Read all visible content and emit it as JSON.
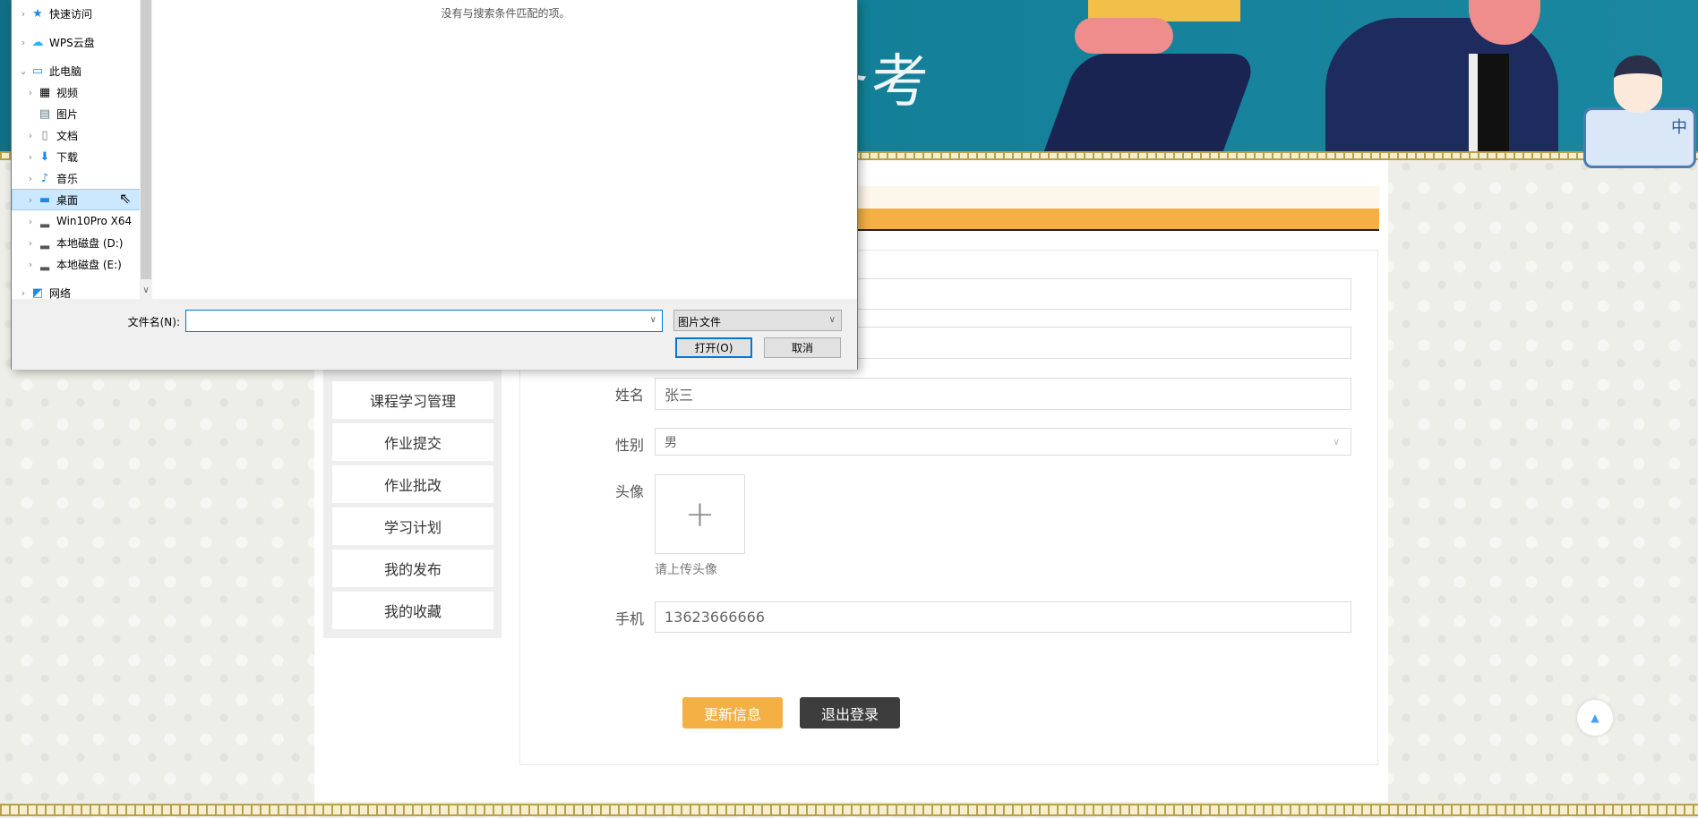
{
  "banner": {
    "title": "备考",
    "mascot_text": "中"
  },
  "menu": {
    "items": [
      "课程学习管理",
      "作业提交",
      "作业批改",
      "学习计划",
      "我的发布",
      "我的收藏"
    ]
  },
  "form": {
    "name_label": "姓名",
    "name_value": "张三",
    "gender_label": "性别",
    "gender_value": "男",
    "avatar_label": "头像",
    "avatar_hint": "请上传头像",
    "phone_label": "手机",
    "phone_value": "13623666666",
    "update_button": "更新信息",
    "logout_button": "退出登录"
  },
  "dialog": {
    "no_match": "没有与搜索条件匹配的项。",
    "tree": [
      {
        "label": "快速访问",
        "icon": "star-icon"
      },
      {
        "label": "WPS云盘",
        "icon": "cloud-icon"
      },
      {
        "label": "此电脑",
        "icon": "computer-icon"
      },
      {
        "label": "视频",
        "icon": "video-icon"
      },
      {
        "label": "图片",
        "icon": "picture-icon"
      },
      {
        "label": "文档",
        "icon": "document-icon"
      },
      {
        "label": "下载",
        "icon": "download-icon"
      },
      {
        "label": "音乐",
        "icon": "music-icon"
      },
      {
        "label": "桌面",
        "icon": "desktop-icon"
      },
      {
        "label": "Win10Pro X64",
        "icon": "drive-icon"
      },
      {
        "label": "本地磁盘 (D:)",
        "icon": "drive-icon"
      },
      {
        "label": "本地磁盘 (E:)",
        "icon": "drive-icon"
      },
      {
        "label": "网络",
        "icon": "network-icon"
      }
    ],
    "filename_label": "文件名(N):",
    "filename_value": "",
    "filetype": "图片文件",
    "open_button": "打开(O)",
    "cancel_button": "取消"
  },
  "colors": {
    "accent": "#f4b045",
    "dark": "#3d3d3d",
    "banner": "#147f98"
  }
}
